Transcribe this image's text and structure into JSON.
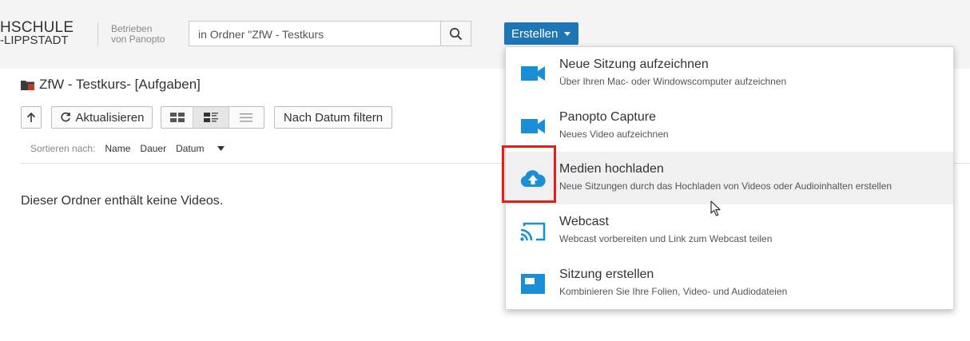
{
  "header": {
    "logo_line1": "HSCHULE",
    "logo_line2": "-LIPPSTADT",
    "powered_line1": "Betrieben",
    "powered_line2": "von Panopto",
    "search_value": "in Ordner \"ZfW - Testkurs",
    "create_label": "Erstellen"
  },
  "folder": {
    "title": "ZfW - Testkurs-  [Aufgaben]"
  },
  "toolbar": {
    "refresh_label": "Aktualisieren",
    "filter_label": "Nach Datum filtern"
  },
  "sort": {
    "label": "Sortieren nach:",
    "options": [
      "Name",
      "Dauer",
      "Datum"
    ]
  },
  "main": {
    "empty_message": "Dieser Ordner enthält keine Videos."
  },
  "menu": {
    "items": [
      {
        "title": "Neue Sitzung aufzeichnen",
        "desc": "Über Ihren Mac- oder Windowscomputer aufzeichnen",
        "icon": "video-camera-icon"
      },
      {
        "title": "Panopto Capture",
        "desc": "Neues Video aufzeichnen",
        "icon": "video-camera-icon"
      },
      {
        "title": "Medien hochladen",
        "desc": "Neue Sitzungen durch das Hochladen von Videos oder Audioinhalten erstellen",
        "icon": "cloud-upload-icon"
      },
      {
        "title": "Webcast",
        "desc": "Webcast vorbereiten und Link zum Webcast teilen",
        "icon": "webcast-icon"
      },
      {
        "title": "Sitzung erstellen",
        "desc": "Kombinieren Sie Ihre Folien, Video- und Audiodateien",
        "icon": "session-icon"
      }
    ]
  },
  "colors": {
    "accent": "#1f76b7",
    "icon_blue": "#1a8fd8",
    "highlight_box": "#e0201c",
    "folder_icon": "#b03a3a"
  }
}
